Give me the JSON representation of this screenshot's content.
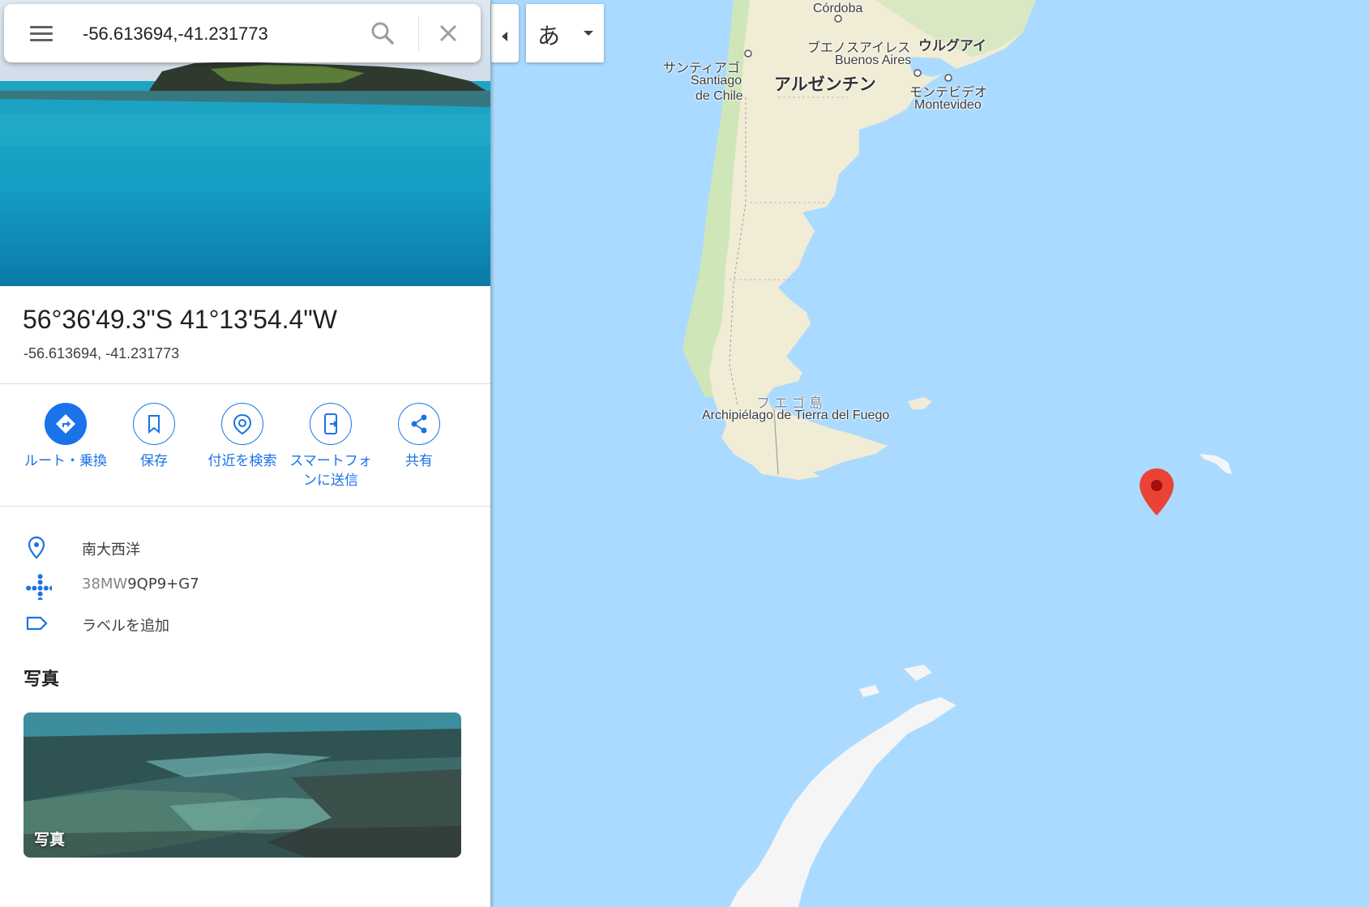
{
  "search": {
    "value": "-56.613694,-41.231773"
  },
  "language_button": {
    "label": "あ"
  },
  "place": {
    "title": "56°36'49.3\"S 41°13'54.4\"W",
    "decimal": "-56.613694, -41.231773"
  },
  "actions": [
    {
      "label": "ルート・乗換",
      "icon": "directions-icon"
    },
    {
      "label": "保存",
      "icon": "bookmark-icon"
    },
    {
      "label": "付近を検索",
      "icon": "nearby-search-icon"
    },
    {
      "label": "スマートフォンに送信",
      "icon": "send-to-phone-icon"
    },
    {
      "label": "共有",
      "icon": "share-icon"
    }
  ],
  "info": {
    "location": "南大西洋",
    "pluscode_prefix": "38MW",
    "pluscode_rest": "9QP9+G7",
    "add_label": "ラベルを追加"
  },
  "photos": {
    "section_title": "写真",
    "card_label": "写真"
  },
  "map_labels": {
    "cordoba": "Córdoba",
    "buenos_aires_jp": "ブエノスアイレス",
    "buenos_aires": "Buenos Aires",
    "uruguay": "ウルグアイ",
    "santiago_jp": "サンティアゴ",
    "santiago_1": "Santiago",
    "santiago_2": "de Chile",
    "argentina": "アルゼンチン",
    "montevideo_jp": "モンテビデオ",
    "montevideo": "Montevideo",
    "fuego_jp": "フ エ ゴ 島",
    "fuego": "Archipiélago de Tierra del Fuego"
  },
  "colors": {
    "water": "#aadaff",
    "land": "#f0ecd6",
    "green": "#cfe6b9",
    "accent": "#1a73e8",
    "pin": "#ea4335"
  }
}
